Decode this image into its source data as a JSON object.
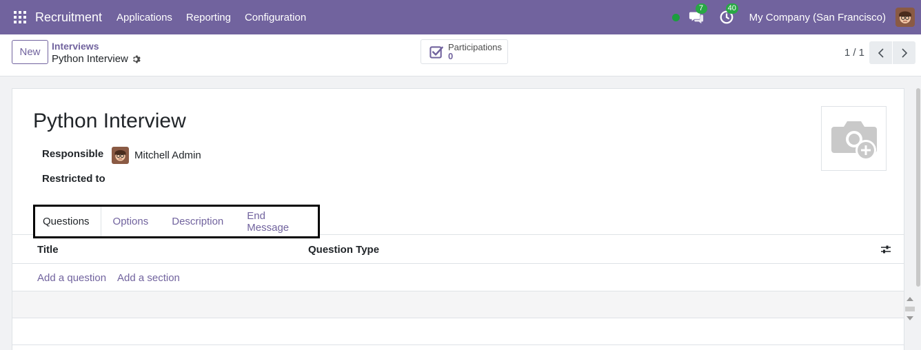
{
  "navbar": {
    "app_name": "Recruitment",
    "menu": [
      "Applications",
      "Reporting",
      "Configuration"
    ],
    "messages_badge": "7",
    "activities_badge": "40",
    "company": "My Company (San Francisco)"
  },
  "control_panel": {
    "new_label": "New",
    "breadcrumb_parent": "Interviews",
    "breadcrumb_current": "Python Interview",
    "smart_button": {
      "label": "Participations",
      "value": "0"
    },
    "pager": "1 / 1"
  },
  "form": {
    "title": "Python Interview",
    "responsible_label": "Responsible",
    "responsible_value": "Mitchell Admin",
    "restricted_label": "Restricted to",
    "tabs": [
      "Questions",
      "Options",
      "Description",
      "End Message"
    ],
    "active_tab": "Questions",
    "columns": [
      "Title",
      "Question Type"
    ],
    "add_question": "Add a question",
    "add_section": "Add a section"
  },
  "colors": {
    "brand": "#71639e",
    "badge": "#28a745",
    "presence": "#1b9e3e"
  }
}
